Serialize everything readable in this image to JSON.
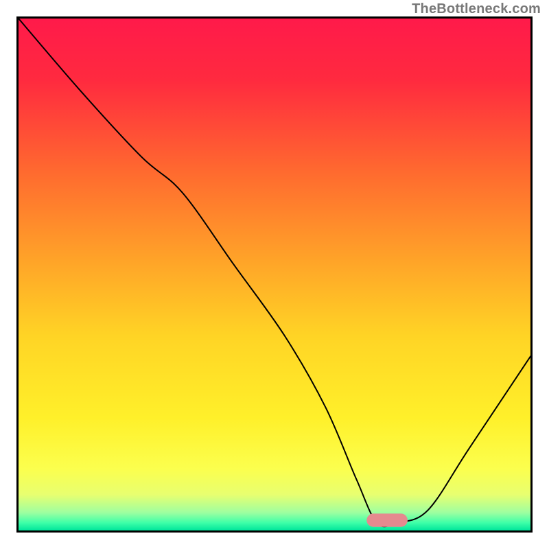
{
  "watermark": "TheBottleneck.com",
  "chart_data": {
    "type": "line",
    "title": "",
    "xlabel": "",
    "ylabel": "",
    "xlim": [
      0,
      100
    ],
    "ylim": [
      0,
      100
    ],
    "grid": false,
    "legend": false,
    "background": {
      "type": "vertical-gradient",
      "stops": [
        {
          "pos": 0.0,
          "color": "#ff1a4a"
        },
        {
          "pos": 0.12,
          "color": "#ff2a3f"
        },
        {
          "pos": 0.3,
          "color": "#ff6a2f"
        },
        {
          "pos": 0.48,
          "color": "#ffa628"
        },
        {
          "pos": 0.62,
          "color": "#ffd425"
        },
        {
          "pos": 0.78,
          "color": "#fff02a"
        },
        {
          "pos": 0.88,
          "color": "#fbff4e"
        },
        {
          "pos": 0.93,
          "color": "#e8ff70"
        },
        {
          "pos": 0.965,
          "color": "#9effa0"
        },
        {
          "pos": 0.985,
          "color": "#3effa8"
        },
        {
          "pos": 1.0,
          "color": "#00e59b"
        }
      ]
    },
    "series": [
      {
        "name": "bottleneck-curve",
        "color": "#000000",
        "x": [
          0,
          12,
          24,
          32,
          42,
          52,
          60,
          66,
          70,
          74,
          80,
          88,
          100
        ],
        "values": [
          100,
          86,
          73,
          66,
          52,
          38,
          24,
          10,
          1.5,
          1.5,
          4,
          16,
          34
        ]
      }
    ],
    "annotations": [
      {
        "name": "optimal-marker",
        "type": "capsule",
        "x_center": 72,
        "y_center": 2,
        "width": 8,
        "height": 2.6,
        "fill": "#e58a8f"
      }
    ]
  }
}
